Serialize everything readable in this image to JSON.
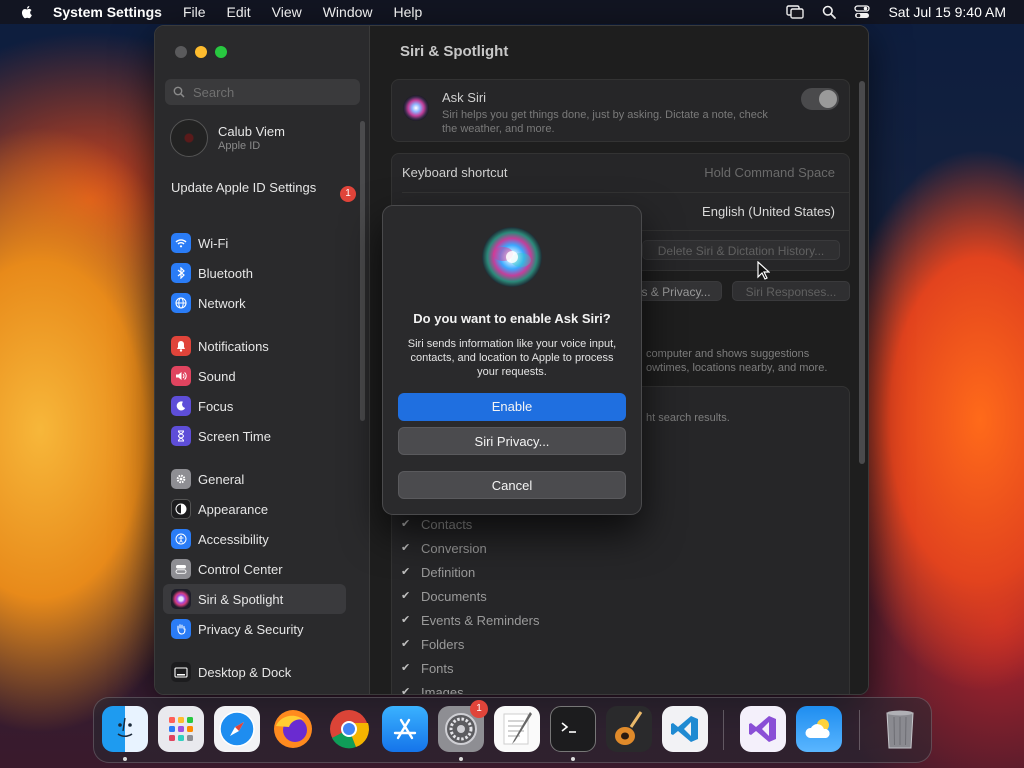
{
  "menubar": {
    "app_name": "System Settings",
    "items": [
      "File",
      "Edit",
      "View",
      "Window",
      "Help"
    ],
    "datetime": "Sat Jul 15  9:40 AM"
  },
  "sidebar": {
    "search_placeholder": "Search",
    "user": {
      "name": "Calub Viem",
      "subtitle": "Apple ID"
    },
    "update": {
      "label": "Update Apple ID Settings",
      "badge": "1"
    },
    "items": [
      {
        "label": "Wi-Fi",
        "icon": "wifi-icon",
        "color": "#2a7cf6"
      },
      {
        "label": "Bluetooth",
        "icon": "bluetooth-icon",
        "color": "#2a7cf6"
      },
      {
        "label": "Network",
        "icon": "globe-icon",
        "color": "#2a7cf6"
      },
      {
        "label": "Notifications",
        "icon": "bell-icon",
        "color": "#e0443a"
      },
      {
        "label": "Sound",
        "icon": "speaker-icon",
        "color": "#e0445f"
      },
      {
        "label": "Focus",
        "icon": "moon-icon",
        "color": "#5e4ed8"
      },
      {
        "label": "Screen Time",
        "icon": "hourglass-icon",
        "color": "#5e4ed8"
      },
      {
        "label": "General",
        "icon": "gear-icon",
        "color": "#8e8e93"
      },
      {
        "label": "Appearance",
        "icon": "appearance-icon",
        "color": "#1c1c1e"
      },
      {
        "label": "Accessibility",
        "icon": "accessibility-icon",
        "color": "#2a7cf6"
      },
      {
        "label": "Control Center",
        "icon": "control-center-icon",
        "color": "#8e8e93"
      },
      {
        "label": "Siri & Spotlight",
        "icon": "siri-icon",
        "color": "#3a3a3c"
      },
      {
        "label": "Privacy & Security",
        "icon": "hand-icon",
        "color": "#2a7cf6"
      },
      {
        "label": "Desktop & Dock",
        "icon": "desktop-icon",
        "color": "#1c1c1e"
      }
    ]
  },
  "content": {
    "title": "Siri & Spotlight",
    "ask_siri": {
      "title": "Ask Siri",
      "description": "Siri helps you get things done, just by asking. Dictate a note, check the weather, and more."
    },
    "keyboard_shortcut": {
      "label": "Keyboard shortcut",
      "value": "Hold Command Space"
    },
    "language_value": "English (United States)",
    "delete_history_button": "Delete Siri & Dictation History...",
    "privacy_button_partial": "s & Privacy...",
    "siri_responses_button": "Siri Responses...",
    "suggestions_text_1": "computer and shows suggestions",
    "suggestions_text_2": "owtimes, locations nearby, and more.",
    "search_results_text": "ht search results.",
    "categories": [
      "Contacts",
      "Conversion",
      "Definition",
      "Documents",
      "Events & Reminders",
      "Folders",
      "Fonts",
      "Images"
    ]
  },
  "dialog": {
    "title": "Do you want to enable Ask Siri?",
    "text": "Siri sends information like your voice input, contacts, and location to Apple to process your requests.",
    "enable_label": "Enable",
    "privacy_label": "Siri Privacy...",
    "cancel_label": "Cancel"
  },
  "dock": {
    "settings_badge": "1",
    "apps": [
      "Finder",
      "Launchpad",
      "Safari",
      "Firefox",
      "Chrome",
      "App Store",
      "System Settings",
      "TextEdit",
      "Terminal",
      "GarageBand",
      "VS Code",
      "Visual Studio",
      "Weather",
      "Trash"
    ]
  },
  "colors": {
    "accent": "#1f6fe0",
    "badge": "#e0443a"
  }
}
